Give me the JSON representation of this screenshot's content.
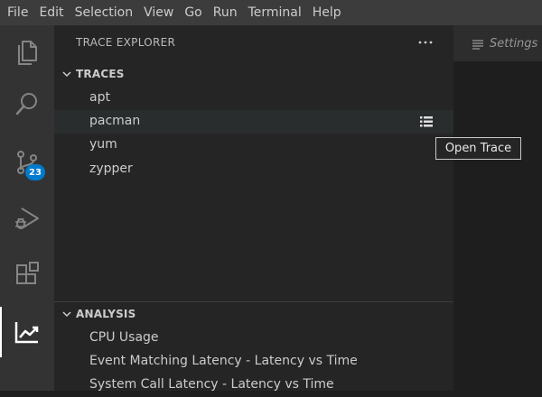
{
  "colors": {
    "activity_bar": "#333333",
    "sidebar": "#252526",
    "menubar": "#3c3c3c",
    "editor": "#1e1e1e",
    "badge": "#007acc",
    "row_hover": "#2a2d2e"
  },
  "menubar": {
    "items": [
      "File",
      "Edit",
      "Selection",
      "View",
      "Go",
      "Run",
      "Terminal",
      "Help"
    ]
  },
  "activity_bar": {
    "items": [
      {
        "name": "explorer",
        "icon": "files-icon"
      },
      {
        "name": "search",
        "icon": "search-icon"
      },
      {
        "name": "source-control",
        "icon": "source-control-icon",
        "badge": "23"
      },
      {
        "name": "run-debug",
        "icon": "run-debug-icon"
      },
      {
        "name": "extensions",
        "icon": "extensions-icon"
      },
      {
        "name": "trace-viewer",
        "icon": "trace-chart-icon",
        "active": true
      }
    ]
  },
  "sidebar": {
    "title": "TRACE EXPLORER",
    "more_icon": "ellipsis-icon",
    "traces": {
      "label": "TRACES",
      "items": [
        "apt",
        "pacman",
        "yum",
        "zypper"
      ],
      "hovered_index": 1,
      "row_action_icon": "list-icon"
    },
    "analysis": {
      "label": "ANALYSIS",
      "items": [
        "CPU Usage",
        "Event Matching Latency - Latency vs Time",
        "System Call Latency - Latency vs Time"
      ]
    }
  },
  "editor": {
    "tab_label": "Settings",
    "tab_icon": "settings-lines-icon"
  },
  "tooltip": {
    "text": "Open Trace"
  }
}
